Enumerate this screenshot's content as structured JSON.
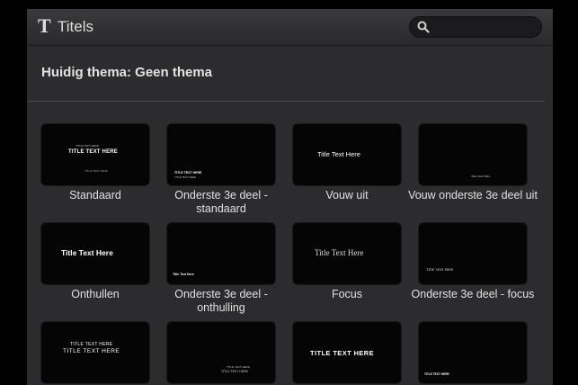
{
  "header": {
    "icon": "T",
    "title": "Titels",
    "search_placeholder": ""
  },
  "theme": {
    "label": "Huidig thema: Geen thema"
  },
  "tiles": [
    {
      "label": "Standaard",
      "line1": "TITLE TEXT HERE",
      "small_a": "TITLE TEXT HERE",
      "small_b": "TITLE TEXT HERE"
    },
    {
      "label": "Onderste 3e deel - standaard",
      "line1": "TITLE TEXT HERE",
      "small_a": "TITLE TEXT HERE"
    },
    {
      "label": "Vouw uit",
      "line1": "Title Text Here"
    },
    {
      "label": "Vouw onderste 3e deel uit",
      "line1": "Title Text Here"
    },
    {
      "label": "Onthullen",
      "line1": "Title Text Here"
    },
    {
      "label": "Onderste 3e deel - onthulling",
      "line1": "Title Text Here"
    },
    {
      "label": "Focus",
      "line1": "Title Text Here"
    },
    {
      "label": "Onderste 3e deel - focus",
      "line1": "Title Text Here"
    },
    {
      "label": "",
      "line1": "TITLE TEXT HERE",
      "line2": "TITLE TEXT HERE"
    },
    {
      "label": "",
      "line1": "TITLE TEXT HERE",
      "line2": "TITLE TEXT HERE"
    },
    {
      "label": "",
      "line1": "TITLE TEXT HERE"
    },
    {
      "label": "",
      "line1": "TITLE TEXT HERE"
    }
  ]
}
